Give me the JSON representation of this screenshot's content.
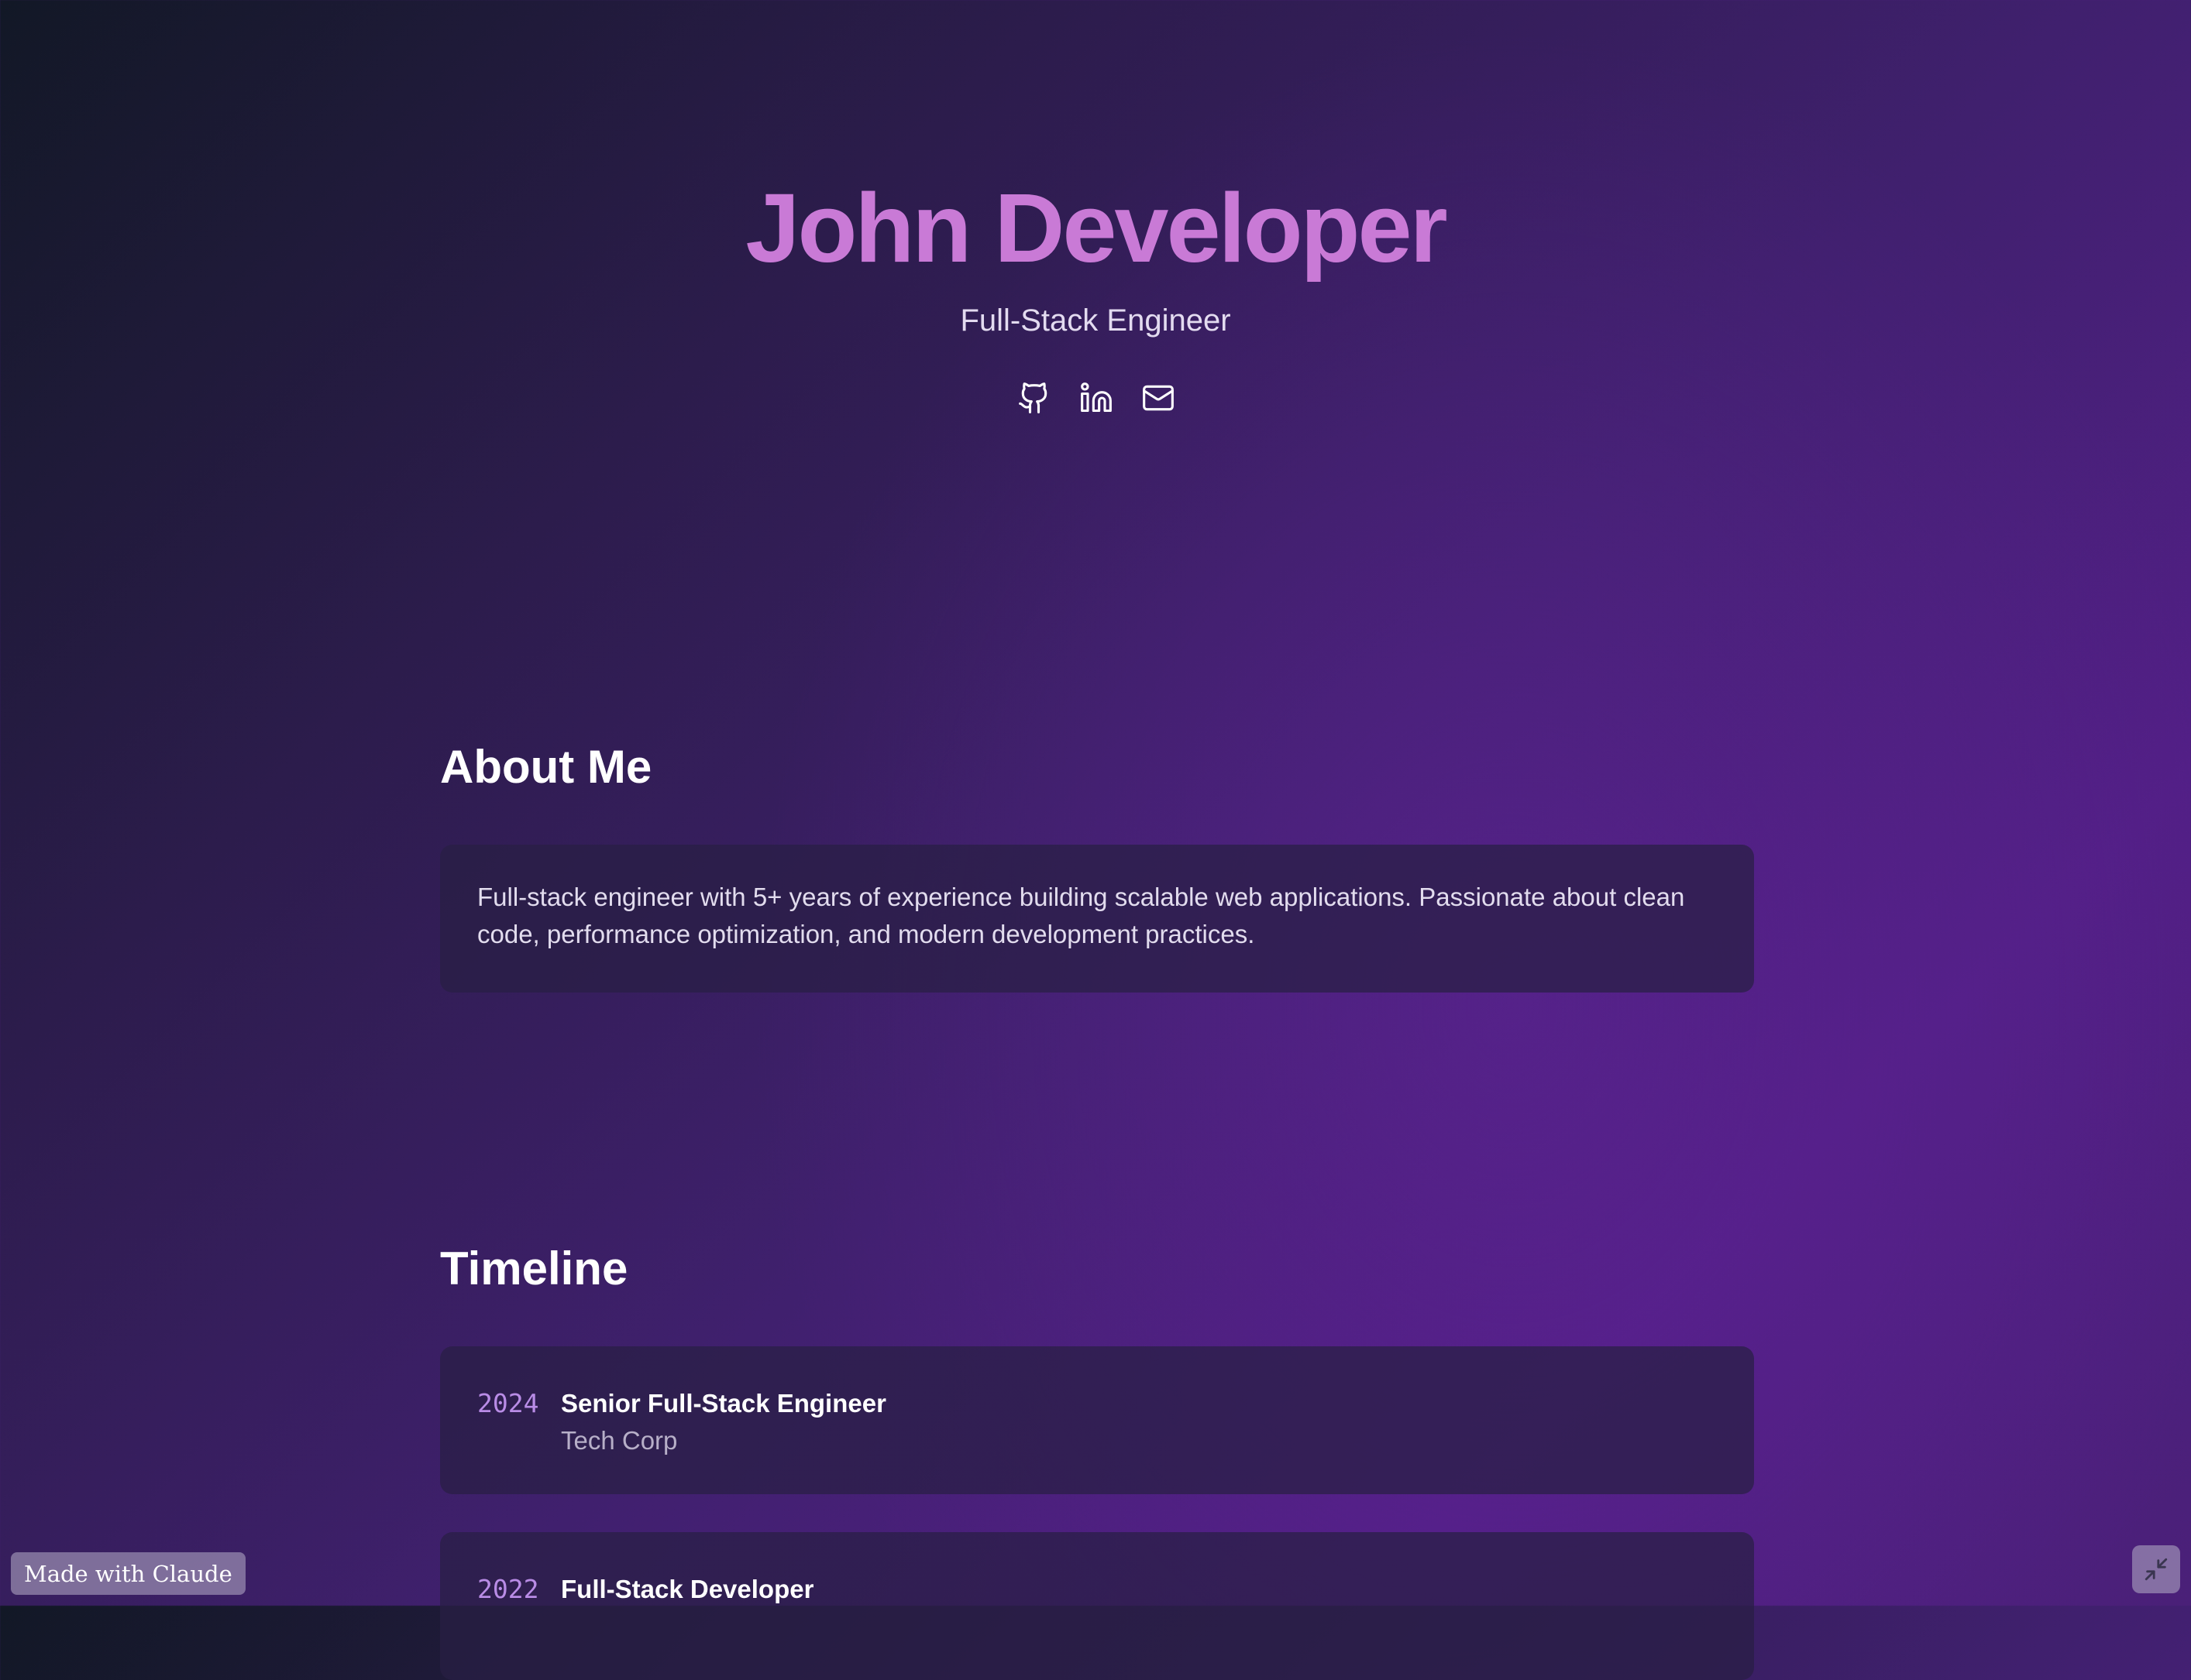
{
  "hero": {
    "name": "John Developer",
    "role": "Full-Stack Engineer",
    "socials": [
      {
        "icon": "github-icon"
      },
      {
        "icon": "linkedin-icon"
      },
      {
        "icon": "mail-icon"
      }
    ]
  },
  "about": {
    "heading": "About Me",
    "text": "Full-stack engineer with 5+ years of experience building scalable web applications. Passionate about clean code, performance optimization, and modern development practices."
  },
  "timeline": {
    "heading": "Timeline",
    "items": [
      {
        "year": "2024",
        "title": "Senior Full-Stack Engineer",
        "company": "Tech Corp"
      },
      {
        "year": "2022",
        "title": "Full-Stack Developer",
        "company": ""
      }
    ]
  },
  "footer": {
    "badge": "Made with Claude",
    "collapse_icon": "collapse-icon"
  },
  "colors": {
    "accent_name": "#c97ad6",
    "accent_year": "#b98ce6",
    "card_bg": "#281e44"
  }
}
